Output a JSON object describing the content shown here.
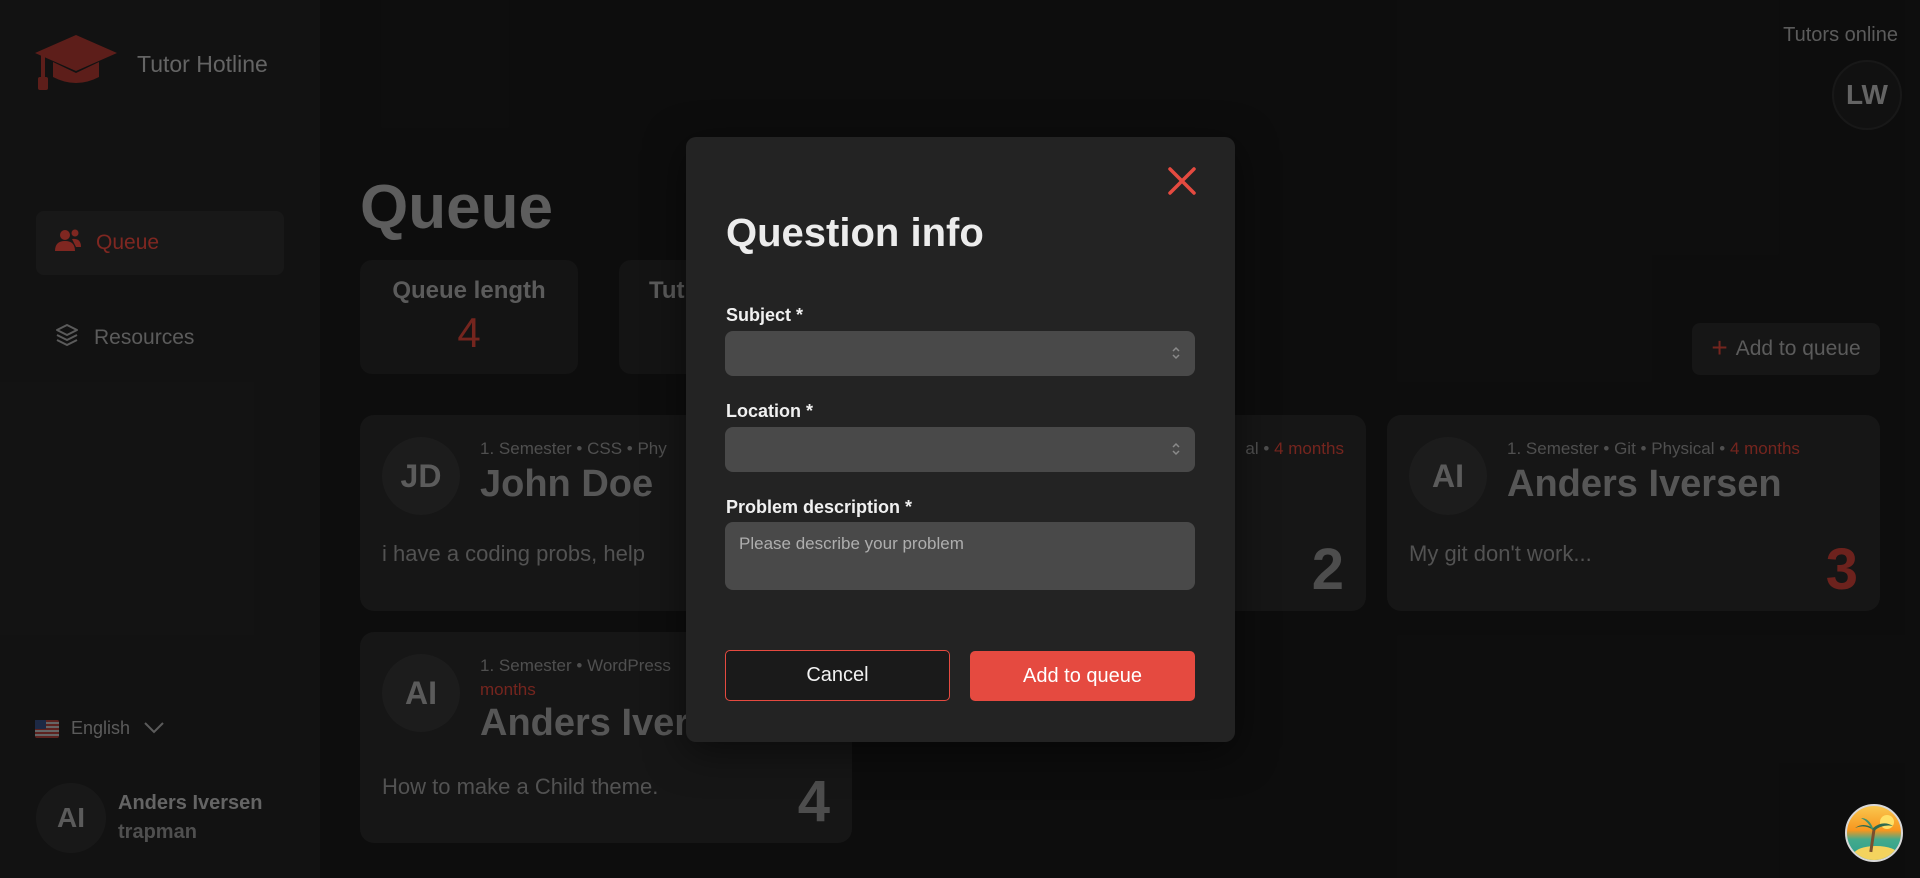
{
  "app": {
    "title": "Tutor Hotline"
  },
  "sidebar": {
    "items": [
      {
        "label": "Queue",
        "icon": "users-icon",
        "active": true
      },
      {
        "label": "Resources",
        "icon": "layers-icon",
        "active": false
      }
    ],
    "language": {
      "label": "English",
      "flag": "us-flag-icon"
    },
    "user": {
      "initials": "AI",
      "name": "Anders Iversen",
      "handle": "trapman"
    }
  },
  "header": {
    "tutors_online_label": "Tutors online",
    "tutors": [
      {
        "initials": "LW"
      }
    ]
  },
  "main": {
    "title": "Queue",
    "stats": [
      {
        "label": "Queue length",
        "value": "4"
      },
      {
        "label": "Tut"
      }
    ],
    "add_button_label": "Add to queue",
    "cards": [
      {
        "initials": "JD",
        "semester": "1. Semester",
        "subject": "CSS",
        "location_partial": "Phy",
        "name": "John Doe",
        "description": "i have a coding probs, help",
        "number": ""
      },
      {
        "meta_partial": "al",
        "age": "4 months",
        "number": "2"
      },
      {
        "initials": "AI",
        "semester": "1. Semester",
        "subject": "Git",
        "location": "Physical",
        "age": "4 months",
        "name": "Anders Iversen",
        "description": "My git don't work...",
        "number": "3"
      },
      {
        "initials": "AI",
        "semester": "1. Semester",
        "subject": "WordPress",
        "age_partial": "months",
        "name_partial": "Anders Iver",
        "description": "How to make a Child theme.",
        "number": "4"
      }
    ],
    "separator": "•"
  },
  "modal": {
    "title": "Question info",
    "subject_label": "Subject *",
    "subject_value": "",
    "location_label": "Location *",
    "location_value": "",
    "description_label": "Problem description *",
    "description_placeholder": "Please describe your problem",
    "cancel_label": "Cancel",
    "submit_label": "Add to queue"
  },
  "colors": {
    "accent": "#e54a40",
    "accent_dim": "#b4392f",
    "background": "#151515",
    "sidebar": "#1d1d1d",
    "modal": "#232323",
    "input": "#494949"
  }
}
